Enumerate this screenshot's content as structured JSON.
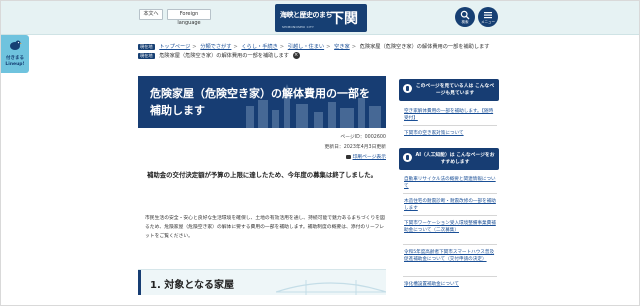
{
  "header": {
    "accessibility_label": "本文へ",
    "language_label": "Foreign language",
    "logo_left": "海峡と歴史のまち",
    "logo_right": "下関",
    "logo_sub": "SHIMONOSEKI CITY",
    "search_label": "検索",
    "menu_label": "メニュー"
  },
  "lineup": {
    "label": "付きまるLineup!"
  },
  "breadcrumb": {
    "tag_current": "現在地",
    "items": [
      "トップページ",
      "分類でさがす",
      "くらし・手続き",
      "引越し・住まい",
      "空き家",
      "危険家屋（危険空き家）の解体費用の一部を補助します"
    ],
    "tag_selected": "現在地",
    "selected": "危険家屋（危険空き家）の解体費用の一部を補助します"
  },
  "page": {
    "title": "危険家屋（危険空き家）の解体費用の一部を補助します",
    "page_id": "ページID：0002600",
    "updated": "更新日：2023年4月3日更新",
    "print_label": "印刷ページ表示",
    "notice": "補助金の交付決定額が予算の上限に達したため、今年度の募集は終了しました。",
    "body": "市民生活の安全・安心と良好な生活環境を確保し、土地の有効活用を通し、持続可能で魅力あるまちづくりを図るため、危険家屋（危険空き家）の解体に要する費用の一部を補助します。補助制度の概要は、添付のリーフレットをご覧ください。",
    "section_title": "1. 対象となる家屋"
  },
  "sidebar": {
    "heading1": "このページを見ている人は こんなページも見ています",
    "links1": [
      "空き家解体費用の一部を補助します。【随時受付】",
      "下関市の空き家対策について"
    ],
    "heading2": "AI（人工知能）は こんなページをおすすめします",
    "links2": [
      "自動車リサイクル法の概要と関連情報について",
      "木造住宅の耐震診断・耐震改修の一部を補助します",
      "下関市ワーケーション受入環境整備事業費補助金について（二次募集）",
      "令和5年度高齢者下関市スマートハウス普及促進補助金について（交付申請の決定）",
      "浄化槽設置補助金について"
    ]
  }
}
